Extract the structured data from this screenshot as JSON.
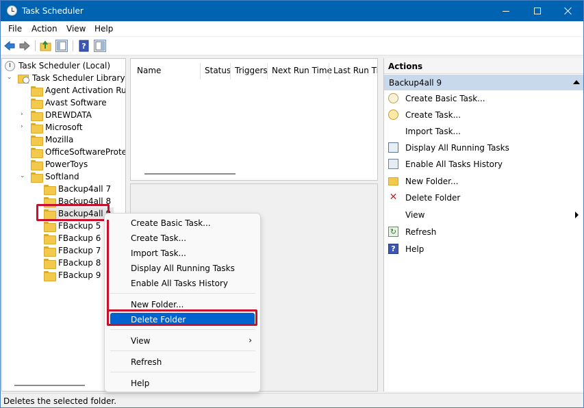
{
  "window": {
    "title": "Task Scheduler"
  },
  "menubar": {
    "items": [
      "File",
      "Action",
      "View",
      "Help"
    ]
  },
  "tree": {
    "root": "Task Scheduler (Local)",
    "library": "Task Scheduler Library",
    "items": [
      {
        "label": "Agent Activation Runt",
        "expandable": false
      },
      {
        "label": "Avast Software",
        "expandable": false
      },
      {
        "label": "DREWDATA",
        "expandable": true
      },
      {
        "label": "Microsoft",
        "expandable": true
      },
      {
        "label": "Mozilla",
        "expandable": false
      },
      {
        "label": "OfficeSoftwareProtect",
        "expandable": false
      },
      {
        "label": "PowerToys",
        "expandable": false
      },
      {
        "label": "Softland",
        "expandable": true
      }
    ],
    "softland_children": [
      "Backup4all 7",
      "Backup4all 8",
      "Backup4all 9",
      "FBackup 5",
      "FBackup 6",
      "FBackup 7",
      "FBackup 8",
      "FBackup 9"
    ],
    "selected": "Backup4all 9"
  },
  "task_list": {
    "columns": [
      "Name",
      "Status",
      "Triggers",
      "Next Run Time",
      "Last Run Tir"
    ]
  },
  "actions": {
    "header": "Actions",
    "section": "Backup4all 9",
    "items": [
      {
        "label": "Create Basic Task...",
        "icon": "create-basic-task-icon"
      },
      {
        "label": "Create Task...",
        "icon": "create-task-icon"
      },
      {
        "label": "Import Task...",
        "icon": ""
      },
      {
        "label": "Display All Running Tasks",
        "icon": "running-tasks-icon"
      },
      {
        "label": "Enable All Tasks History",
        "icon": "tasks-history-icon"
      },
      {
        "label": "New Folder...",
        "icon": "new-folder-icon"
      },
      {
        "label": "Delete Folder",
        "icon": "delete-icon"
      },
      {
        "label": "View",
        "icon": ""
      },
      {
        "label": "Refresh",
        "icon": "refresh-icon"
      },
      {
        "label": "Help",
        "icon": "help-icon"
      }
    ]
  },
  "context_menu": {
    "items": [
      "Create Basic Task...",
      "Create Task...",
      "Import Task...",
      "Display All Running Tasks",
      "Enable All Tasks History",
      "New Folder...",
      "Delete Folder",
      "View",
      "Refresh",
      "Help"
    ],
    "highlighted": "Delete Folder",
    "submenu_glyph": "›"
  },
  "statusbar": {
    "text": "Deletes the selected folder."
  },
  "colors": {
    "titlebar": "#0063b1",
    "highlight": "#0063cf",
    "annotation": "#c8102e",
    "actions_section": "#c9d9ec"
  }
}
